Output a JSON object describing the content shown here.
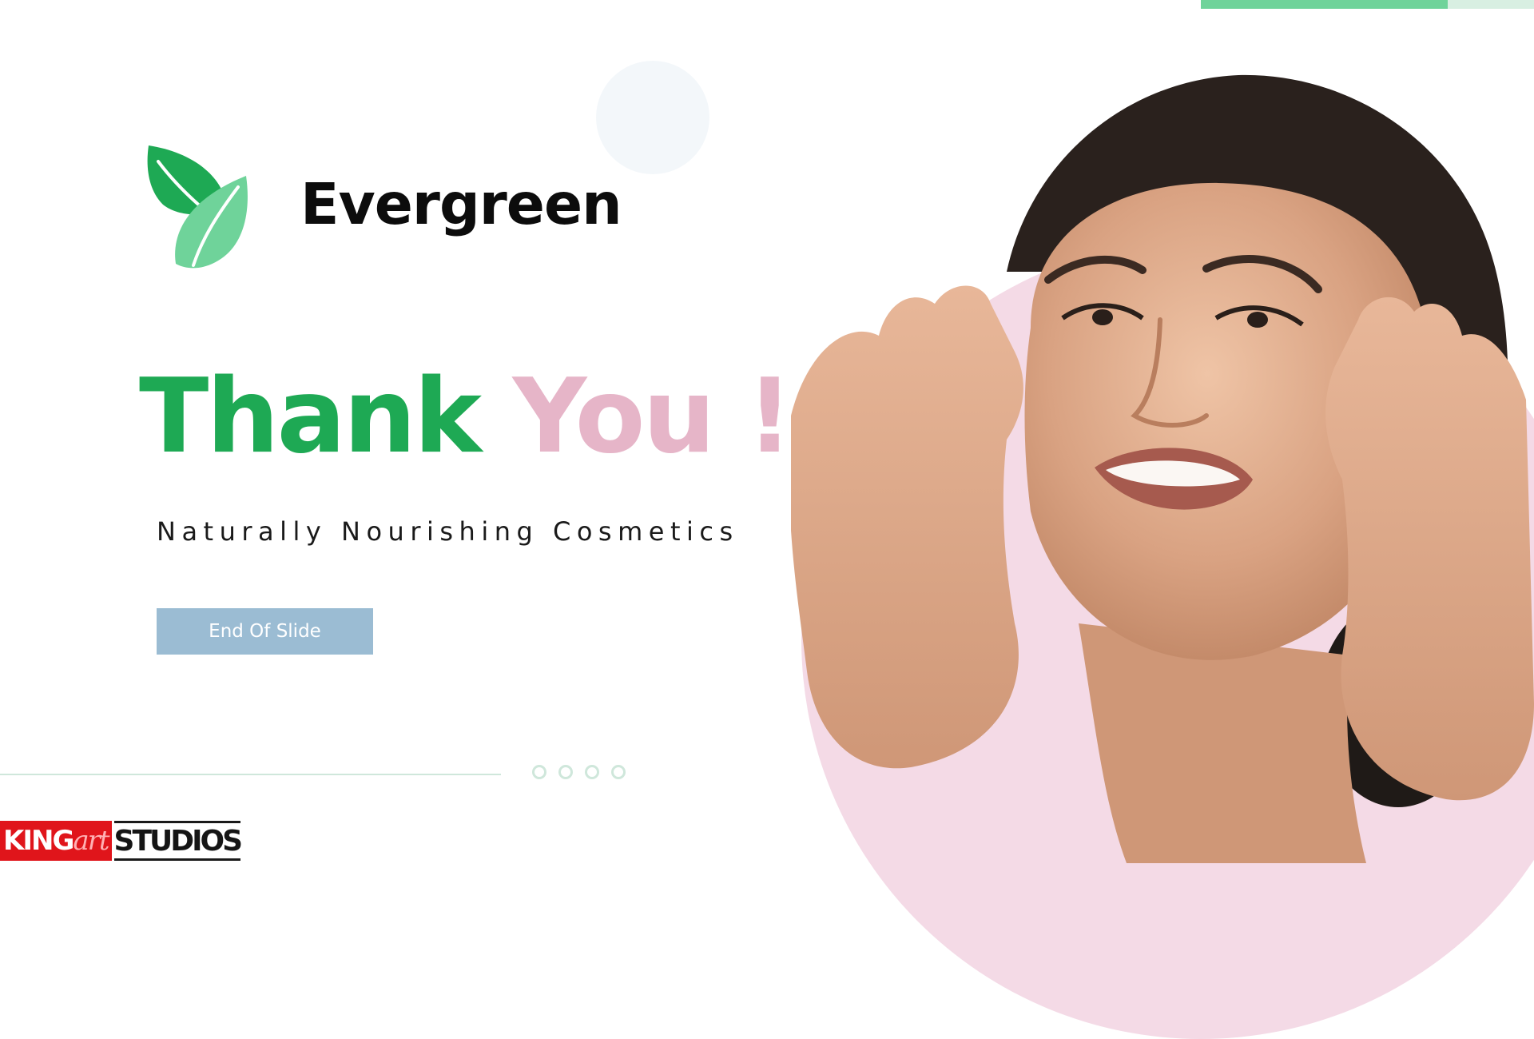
{
  "brand": {
    "name": "Evergreen"
  },
  "title": {
    "part1": "Thank",
    "part2": "You !"
  },
  "tagline": "Naturally Nourishing Cosmetics",
  "button": {
    "label": "End Of Slide"
  },
  "pagination": {
    "dot_count": 4
  },
  "watermark": {
    "part1": "KING",
    "part2": "art",
    "part3": "STUDIOS"
  },
  "colors": {
    "green": "#1ea954",
    "light_green": "#6fd39a",
    "pink": "#e6b5c8",
    "pink_bg": "#f4dae6",
    "button_blue": "#9bbcd3"
  },
  "icons": [
    "leaf-logo-icon"
  ]
}
